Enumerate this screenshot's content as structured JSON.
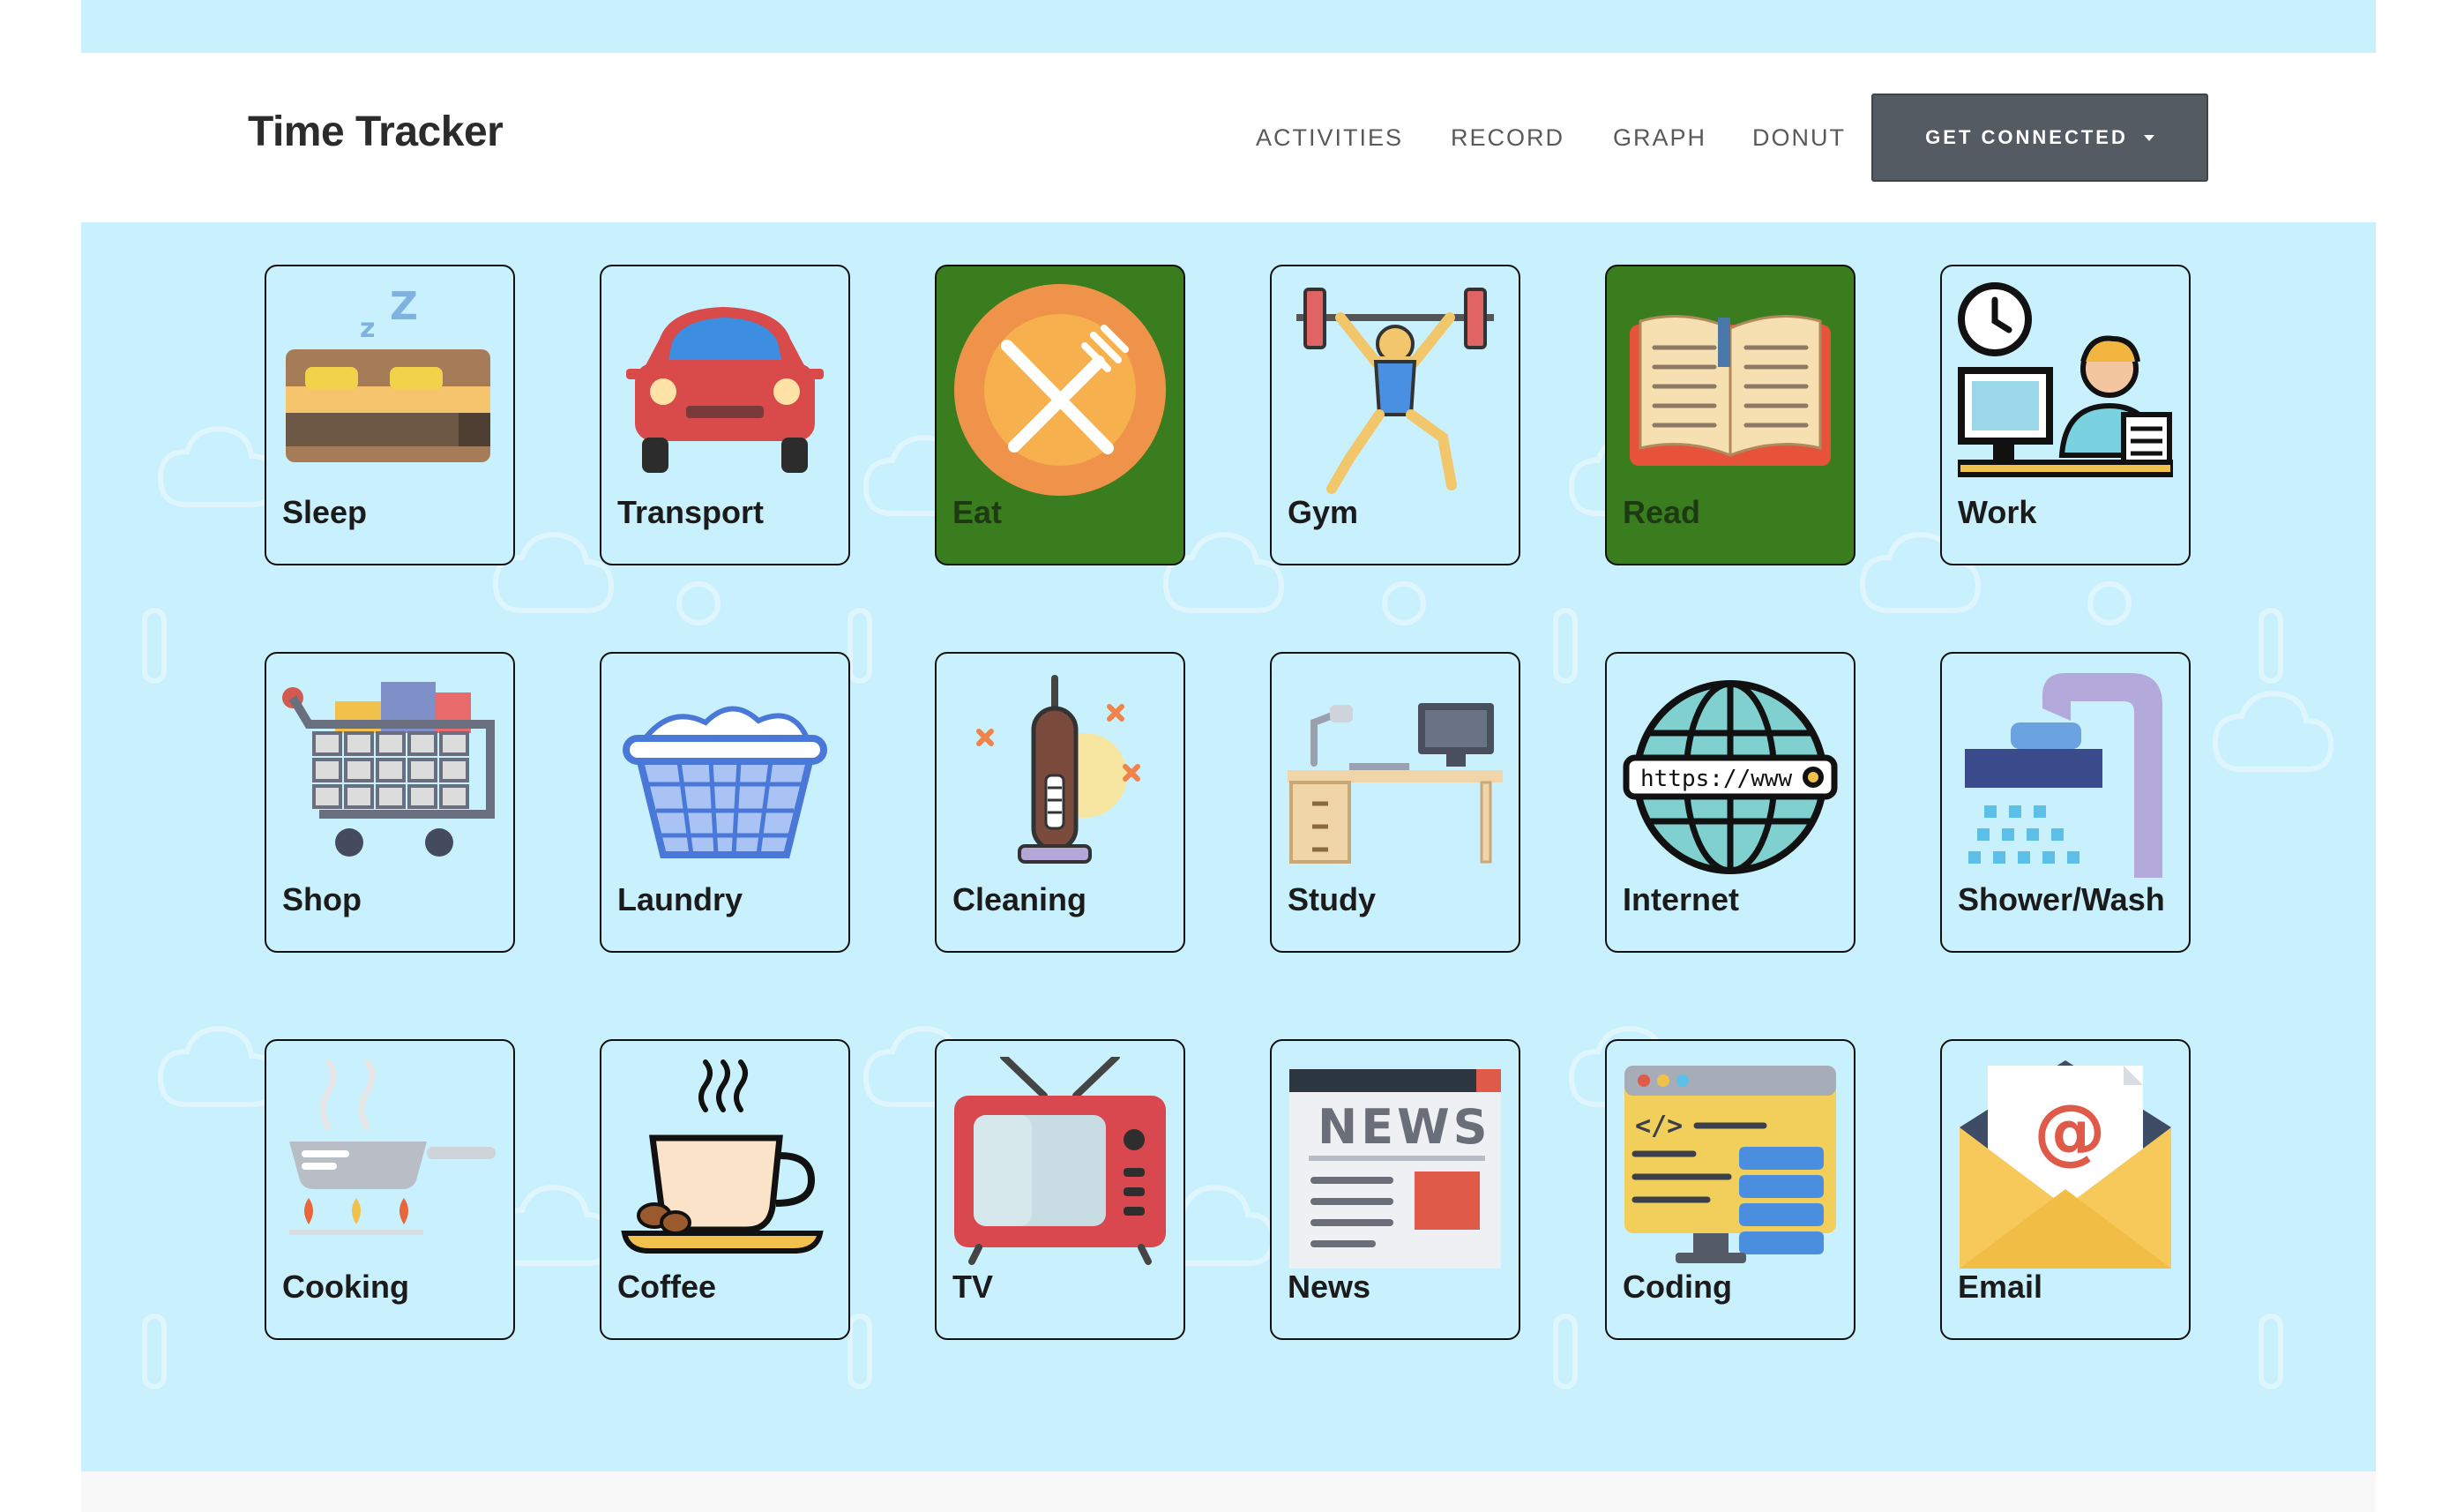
{
  "app": {
    "brand": "Time Tracker"
  },
  "nav": {
    "links": [
      "ACTIVITIES",
      "RECORD",
      "GRAPH",
      "DONUT"
    ],
    "cta": "GET CONNECTED"
  },
  "activities": [
    {
      "label": "Sleep",
      "icon": "bed-icon",
      "selected": false
    },
    {
      "label": "Transport",
      "icon": "car-icon",
      "selected": false
    },
    {
      "label": "Eat",
      "icon": "plate-cutlery-icon",
      "selected": true
    },
    {
      "label": "Gym",
      "icon": "weightlifter-icon",
      "selected": false
    },
    {
      "label": "Read",
      "icon": "open-book-icon",
      "selected": true
    },
    {
      "label": "Work",
      "icon": "office-worker-icon",
      "selected": false
    },
    {
      "label": "Shop",
      "icon": "shopping-cart-icon",
      "selected": false
    },
    {
      "label": "Laundry",
      "icon": "laundry-basket-icon",
      "selected": false
    },
    {
      "label": "Cleaning",
      "icon": "vacuum-cleaner-icon",
      "selected": false
    },
    {
      "label": "Study",
      "icon": "desk-icon",
      "selected": false
    },
    {
      "label": "Internet",
      "icon": "globe-icon",
      "selected": false
    },
    {
      "label": "Shower/Wash",
      "icon": "shower-icon",
      "selected": false
    },
    {
      "label": "Cooking",
      "icon": "frying-pan-icon",
      "selected": false
    },
    {
      "label": "Coffee",
      "icon": "coffee-cup-icon",
      "selected": false
    },
    {
      "label": "TV",
      "icon": "television-icon",
      "selected": false
    },
    {
      "label": "News",
      "icon": "newspaper-icon",
      "selected": false
    },
    {
      "label": "Coding",
      "icon": "code-monitor-icon",
      "selected": false
    },
    {
      "label": "Email",
      "icon": "email-envelope-icon",
      "selected": false
    }
  ],
  "icon_text": {
    "internet": "https://www",
    "news": "NEWS",
    "email": "@",
    "coding": "</>"
  },
  "colors": {
    "background": "#c9f0fd",
    "selected_tile": "#3a7d1e",
    "cta": "#545b62"
  }
}
